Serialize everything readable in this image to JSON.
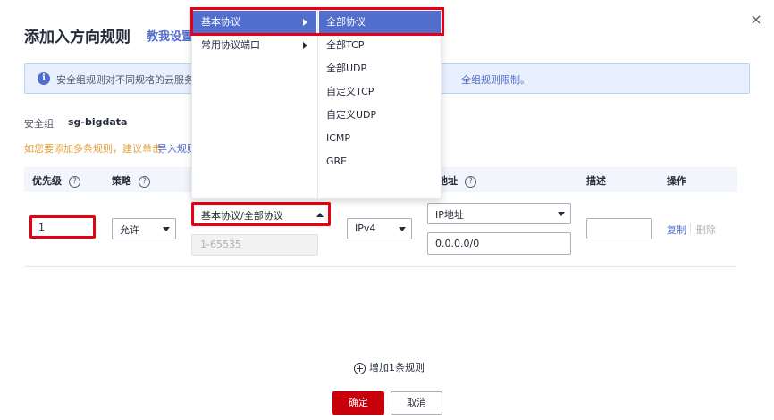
{
  "dialog": {
    "title": "添加入方向规则",
    "tutorial_link": "教我设置",
    "close_glyph": "×"
  },
  "info": {
    "icon_glyph": "i",
    "text": "安全组规则对不同规格的云服务器",
    "text_tail": "全组规则限制。"
  },
  "security_group": {
    "label": "安全组",
    "value": "sg-bigdata"
  },
  "hint": {
    "text": "如您要添加多条规则，建议单击",
    "link": "导入规则"
  },
  "table": {
    "headers": {
      "priority": "优先级",
      "policy": "策略",
      "address": "地址",
      "description": "描述",
      "actions": "操作"
    },
    "help_glyph": "?",
    "row": {
      "priority": "1",
      "policy": "允许",
      "protocol": "基本协议/全部协议",
      "port_placeholder": "1-65535",
      "ip_version": "IPv4",
      "address_type": "IP地址",
      "address_value": "0.0.0.0/0",
      "description": "",
      "copy": "复制",
      "delete": "删除"
    }
  },
  "add_row": {
    "plus_glyph": "+",
    "label": "增加1条规则"
  },
  "buttons": {
    "ok": "确定",
    "cancel": "取消"
  },
  "protocol_menu": {
    "categories": [
      {
        "label": "基本协议",
        "active": true
      },
      {
        "label": "常用协议端口",
        "active": false
      }
    ],
    "sub_items": [
      {
        "label": "全部协议",
        "active": true
      },
      {
        "label": "全部TCP",
        "active": false
      },
      {
        "label": "全部UDP",
        "active": false
      },
      {
        "label": "自定义TCP",
        "active": false
      },
      {
        "label": "自定义UDP",
        "active": false
      },
      {
        "label": "ICMP",
        "active": false
      },
      {
        "label": "GRE",
        "active": false
      }
    ]
  },
  "colors": {
    "accent": "#526ecc",
    "primary_button": "#c7000b",
    "highlight_box": "#e60012",
    "hint": "#e6a23c"
  }
}
